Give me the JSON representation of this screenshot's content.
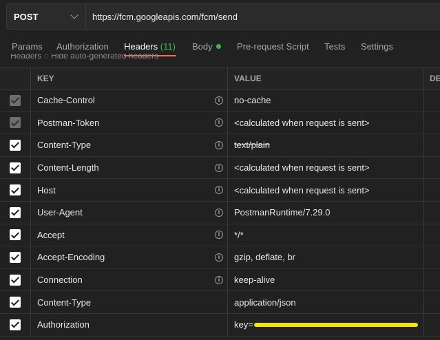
{
  "request": {
    "method": "POST",
    "url": "https://fcm.googleapis.com/fcm/send"
  },
  "tabs": [
    {
      "label": "Params"
    },
    {
      "label": "Authorization"
    },
    {
      "label": "Headers",
      "count": "(11)"
    },
    {
      "label": "Body"
    },
    {
      "label": "Pre-request Script"
    },
    {
      "label": "Tests"
    },
    {
      "label": "Settings"
    }
  ],
  "ghost_text": "Headers  ◌ Hide auto-generated headers",
  "table": {
    "headers": {
      "key": "KEY",
      "value": "VALUE",
      "description": "DE"
    },
    "rows": [
      {
        "key": "Cache-Control",
        "value": "no-cache",
        "checked": true,
        "disabled": true,
        "info": true
      },
      {
        "key": "Postman-Token",
        "value": "<calculated when request is sent>",
        "checked": true,
        "disabled": true,
        "info": true
      },
      {
        "key": "Content-Type",
        "value": "text/plain",
        "checked": true,
        "disabled": false,
        "info": true,
        "strikethrough": true
      },
      {
        "key": "Content-Length",
        "value": "<calculated when request is sent>",
        "checked": true,
        "disabled": false,
        "info": true
      },
      {
        "key": "Host",
        "value": "<calculated when request is sent>",
        "checked": true,
        "disabled": false,
        "info": true
      },
      {
        "key": "User-Agent",
        "value": "PostmanRuntime/7.29.0",
        "checked": true,
        "disabled": false,
        "info": true
      },
      {
        "key": "Accept",
        "value": "*/*",
        "checked": true,
        "disabled": false,
        "info": true
      },
      {
        "key": "Accept-Encoding",
        "value": "gzip, deflate, br",
        "checked": true,
        "disabled": false,
        "info": true
      },
      {
        "key": "Connection",
        "value": "keep-alive",
        "checked": true,
        "disabled": false,
        "info": true
      },
      {
        "key": "Content-Type",
        "value": "application/json",
        "checked": true,
        "disabled": false,
        "info": false
      },
      {
        "key": "Authorization",
        "value": "key=",
        "checked": true,
        "disabled": false,
        "info": false,
        "redacted": true
      }
    ]
  },
  "info_glyph": "i",
  "colors": {
    "background": "#212121",
    "accent_underline": "#ff6c37",
    "count_green": "#3dba4e",
    "redaction_highlight": "#f2e600"
  }
}
